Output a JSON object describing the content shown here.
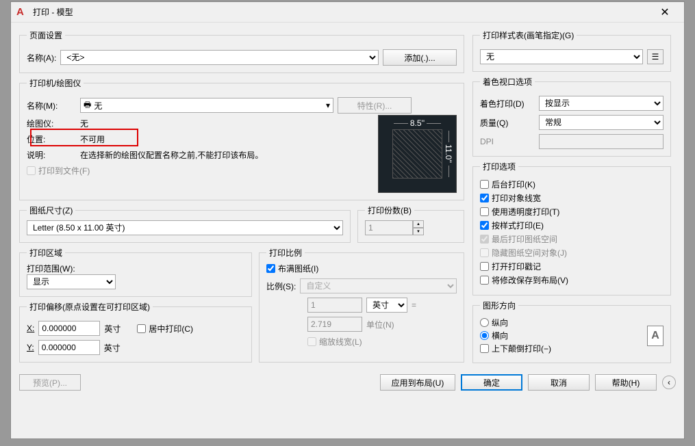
{
  "titlebar": {
    "title": "打印 - 模型"
  },
  "pageSetup": {
    "legend": "页面设置",
    "nameLabel": "名称(A):",
    "nameValue": "<无>",
    "addBtn": "添加(.)..."
  },
  "printer": {
    "legend": "打印机/绘图仪",
    "nameLabel": "名称(M):",
    "nameValue": "无",
    "propsBtn": "特性(R)...",
    "plotterLabel": "绘图仪:",
    "plotterValue": "无",
    "locationLabel": "位置:",
    "locationValue": "不可用",
    "descLabel": "说明:",
    "descValue": "在选择新的绘图仪配置名称之前,不能打印该布局。",
    "plotToFile": "打印到文件(F)",
    "paperW": "8.5''",
    "paperH": "11.0''"
  },
  "paperSize": {
    "legend": "图纸尺寸(Z)",
    "value": "Letter (8.50 x 11.00 英寸)"
  },
  "copies": {
    "legend": "打印份数(B)",
    "value": "1"
  },
  "area": {
    "legend": "打印区域",
    "whatLabel": "打印范围(W):",
    "whatValue": "显示"
  },
  "scale": {
    "legend": "打印比例",
    "fitLabel": "布满图纸(I)",
    "scaleLabel": "比例(S):",
    "scaleValue": "自定义",
    "v1": "1",
    "unit1": "英寸",
    "v2": "2.719",
    "unit2Label": "单位(N)",
    "scaleLW": "缩放线宽(L)"
  },
  "offset": {
    "legend": "打印偏移(原点设置在可打印区域)",
    "xLabel": "X:",
    "xValue": "0.000000",
    "xUnit": "英寸",
    "yLabel": "Y:",
    "yValue": "0.000000",
    "yUnit": "英寸",
    "center": "居中打印(C)"
  },
  "styleTable": {
    "legend": "打印样式表(画笔指定)(G)",
    "value": "无"
  },
  "shaded": {
    "legend": "着色视口选项",
    "shadeLabel": "着色打印(D)",
    "shadeValue": "按显示",
    "qualityLabel": "质量(Q)",
    "qualityValue": "常规",
    "dpiLabel": "DPI"
  },
  "options": {
    "legend": "打印选项",
    "o1": "后台打印(K)",
    "o2": "打印对象线宽",
    "o3": "使用透明度打印(T)",
    "o4": "按样式打印(E)",
    "o5": "最后打印图纸空间",
    "o6": "隐藏图纸空间对象(J)",
    "o7": "打开打印戳记",
    "o8": "将修改保存到布局(V)"
  },
  "orient": {
    "legend": "图形方向",
    "r1": "纵向",
    "r2": "横向",
    "c1": "上下颠倒打印(−)"
  },
  "footer": {
    "preview": "预览(P)...",
    "apply": "应用到布局(U)",
    "ok": "确定",
    "cancel": "取消",
    "help": "帮助(H)"
  }
}
